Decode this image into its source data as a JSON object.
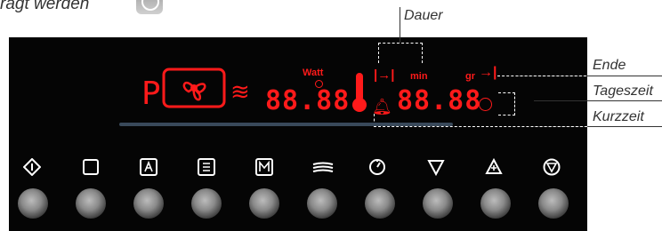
{
  "top_fragment": "ragt werden",
  "callouts": {
    "dauer": "Dauer",
    "ende": "Ende",
    "tageszeit": "Tageszeit",
    "kurzzeit": "Kurzzeit"
  },
  "display": {
    "program_letter": "P",
    "power_value": "88.88",
    "time_value": "88.88",
    "unit_watt": "Watt",
    "unit_min": "min",
    "unit_gr": "gr",
    "active_color": "#ff1a1a"
  },
  "buttons": [
    {
      "icon": "start-diamond-icon"
    },
    {
      "icon": "square-icon"
    },
    {
      "icon": "a-icon"
    },
    {
      "icon": "list-icon"
    },
    {
      "icon": "m-icon"
    },
    {
      "icon": "waves-icon"
    },
    {
      "icon": "clock-icon"
    },
    {
      "icon": "down-triangle-icon"
    },
    {
      "icon": "up-triangle-icon"
    },
    {
      "icon": "stop-icon"
    }
  ]
}
